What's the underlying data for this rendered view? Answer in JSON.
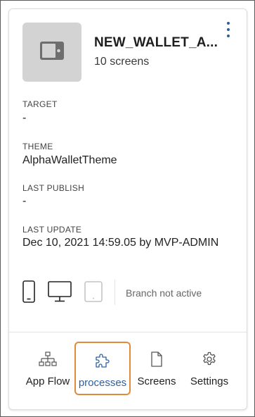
{
  "app": {
    "title": "NEW_WALLET_A...",
    "subtitle": "10 screens"
  },
  "fields": [
    {
      "label": "TARGET",
      "value": "-"
    },
    {
      "label": "THEME",
      "value": "AlphaWalletTheme"
    },
    {
      "label": "LAST PUBLISH",
      "value": "-"
    },
    {
      "label": "LAST UPDATE",
      "value": "Dec 10, 2021 14:59.05 by MVP-ADMIN"
    }
  ],
  "devices": {
    "branch_status": "Branch not active"
  },
  "actions": [
    {
      "label": "App Flow",
      "icon": "sitemap-icon"
    },
    {
      "label": "processes",
      "icon": "puzzle-icon",
      "active": true
    },
    {
      "label": "Screens",
      "icon": "document-icon"
    },
    {
      "label": "Settings",
      "icon": "gear-icon"
    }
  ],
  "colors": {
    "accent": "#2d5fa1",
    "highlight_border": "#e08b3c",
    "thumbnail_bg": "#d3d3d3"
  }
}
